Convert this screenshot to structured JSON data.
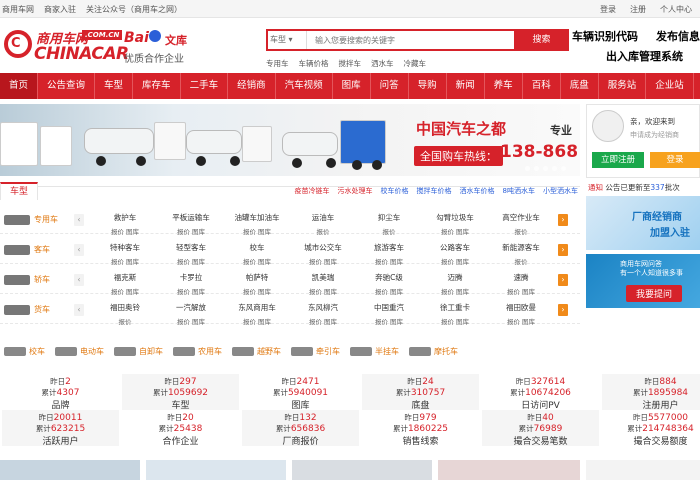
{
  "topbar": {
    "left": [
      "商用车网",
      "商家入驻",
      "关注公众号（商用车之网）"
    ],
    "right": [
      "登录",
      "注册",
      "个人中心"
    ]
  },
  "header": {
    "logo_cn": "商用车网",
    "logo_com": ".COM.CN",
    "logo_en": "CHINACAR",
    "baidu": "Bai",
    "baidu_wenku": "文库",
    "partner": "优质合作企业",
    "search_select": "车型 ▾",
    "search_placeholder": "输入您要搜索的关键字",
    "search_button": "搜索",
    "hot_links": [
      "专用车",
      "车辆价格",
      "搅拌车",
      "洒水车",
      "冷藏车"
    ],
    "vin": "车辆识别代码",
    "release": "发布信息",
    "stock_mgr": "出入库管理系统"
  },
  "nav": [
    "首页",
    "公告查询",
    "车型",
    "库存车",
    "二手车",
    "经销商",
    "汽车视频",
    "图库",
    "问答",
    "导购",
    "新闻",
    "养车",
    "百科",
    "底盘",
    "服务站",
    "企业站"
  ],
  "banner": {
    "title": "中国汽车之都",
    "title_suffix": "专业",
    "hotline_label": "全国购车热线：",
    "phone": "138-868"
  },
  "login": {
    "greeting": "亲，欢迎来到",
    "sub": "申请成为经销商",
    "register": "立即注册",
    "login": "登录"
  },
  "notice": {
    "label": "通知",
    "text_pre": "公告已更新至",
    "count": "337",
    "text_post": "批次"
  },
  "ads": {
    "ad1_title": "厂商经销商",
    "ad1_sub": "加盟入驻",
    "ad2_title": "商用车网问答",
    "ad2_sub": "有一个人知道很多事",
    "ad2_button": "我要提问"
  },
  "category": {
    "tab": "车型",
    "links": [
      {
        "text": "疫苗冷链车",
        "red": true
      },
      {
        "text": "污水处理车",
        "red": true
      },
      {
        "text": "校车价格",
        "red": false
      },
      {
        "text": "搅拌车价格",
        "red": false
      },
      {
        "text": "洒水车价格",
        "red": false
      },
      {
        "text": "8吨洒水车",
        "red": false
      },
      {
        "text": "小型洒水车",
        "red": false
      }
    ],
    "rows": [
      {
        "name": "专用车",
        "items": [
          {
            "name": "救护车",
            "sub": "报价 图库"
          },
          {
            "name": "平板运输车",
            "sub": "报价 图库"
          },
          {
            "name": "油罐车加油车",
            "sub": "报价 图库"
          },
          {
            "name": "运油车",
            "sub": "报价"
          },
          {
            "name": "抑尘车",
            "sub": "报价"
          },
          {
            "name": "勾臂垃圾车",
            "sub": "报价 图库"
          },
          {
            "name": "高空作业车",
            "sub": "报价"
          }
        ]
      },
      {
        "name": "客车",
        "items": [
          {
            "name": "特种客车",
            "sub": "报价 图库"
          },
          {
            "name": "轻型客车",
            "sub": "报价 图库"
          },
          {
            "name": "校车",
            "sub": "报价 图库"
          },
          {
            "name": "城市公交车",
            "sub": "报价 图库"
          },
          {
            "name": "旅游客车",
            "sub": "报价 图库"
          },
          {
            "name": "公路客车",
            "sub": "报价 图库"
          },
          {
            "name": "新能源客车",
            "sub": "报价"
          }
        ]
      },
      {
        "name": "轿车",
        "items": [
          {
            "name": "福克斯",
            "sub": "报价 图库"
          },
          {
            "name": "卡罗拉",
            "sub": "报价 图库"
          },
          {
            "name": "帕萨特",
            "sub": "报价 图库"
          },
          {
            "name": "凯美瑞",
            "sub": "报价 图库"
          },
          {
            "name": "奔驰C级",
            "sub": "报价 图库"
          },
          {
            "name": "迈腾",
            "sub": "报价 图库"
          },
          {
            "name": "速腾",
            "sub": "报价 图库"
          }
        ]
      },
      {
        "name": "货车",
        "items": [
          {
            "name": "福田奥铃",
            "sub": "报价"
          },
          {
            "name": "一汽解放",
            "sub": "报价 图库"
          },
          {
            "name": "东风商用车",
            "sub": "报价 图库"
          },
          {
            "name": "东风柳汽",
            "sub": "报价 图库"
          },
          {
            "name": "中国重汽",
            "sub": "报价 图库"
          },
          {
            "name": "徐工重卡",
            "sub": "报价 图库"
          },
          {
            "name": "福田欧曼",
            "sub": "报价 图库"
          }
        ]
      }
    ],
    "bottom": [
      "校车",
      "电动车",
      "自卸车",
      "农用车",
      "越野车",
      "牵引车",
      "半挂车",
      "摩托车"
    ]
  },
  "stats": [
    {
      "y": "2",
      "t": "4307",
      "label": "品牌"
    },
    {
      "y": "297",
      "t": "1059692",
      "label": "车型"
    },
    {
      "y": "2471",
      "t": "5940091",
      "label": "图库"
    },
    {
      "y": "24",
      "t": "310757",
      "label": "底盘"
    },
    {
      "y": "327614",
      "t": "10674206",
      "label": "日访问PV"
    },
    {
      "y": "884",
      "t": "1895984",
      "label": "注册用户"
    },
    {
      "y": "20011",
      "t": "623215",
      "label": "活跃用户"
    },
    {
      "y": "20",
      "t": "25438",
      "label": "合作企业"
    },
    {
      "y": "132",
      "t": "656836",
      "label": "厂商报价"
    },
    {
      "y": "979",
      "t": "1860225",
      "label": "销售线索"
    },
    {
      "y": "40",
      "t": "76989",
      "label": "撮合交易笔数"
    },
    {
      "y": "5577000",
      "t": "214748364",
      "label": "撮合交易额度"
    }
  ],
  "stat_labels": {
    "yesterday": "昨日",
    "total": "累计"
  }
}
